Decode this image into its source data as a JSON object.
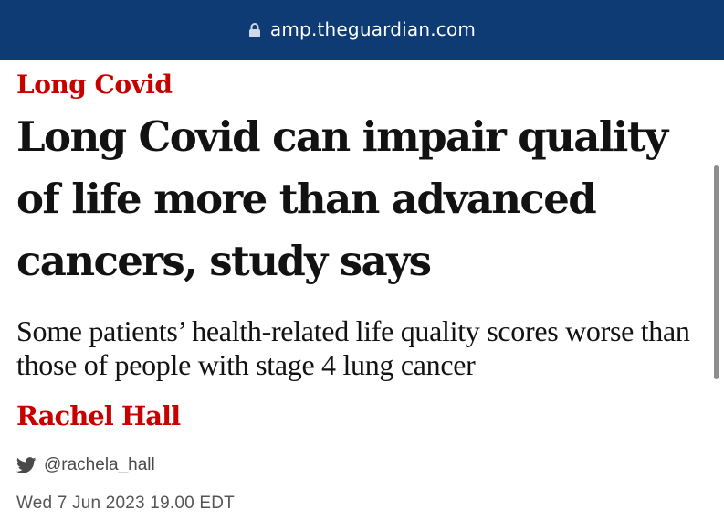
{
  "browser": {
    "url": "amp.theguardian.com",
    "lock_icon": "lock-icon"
  },
  "article": {
    "section": "Long Covid",
    "headline": "Long Covid can impair quality of life more than advanced cancers, study says",
    "standfirst": "Some patients’ health-related life quality scores worse than those of people with stage 4 lung cancer",
    "author": "Rachel Hall",
    "twitter_handle": "@rachela_hall",
    "twitter_icon": "twitter-bird-icon",
    "date": "Wed 7 Jun 2023 19.00 EDT"
  },
  "colors": {
    "url_bar": "#0e3b73",
    "section_red": "#c70000",
    "headline": "#121212"
  }
}
